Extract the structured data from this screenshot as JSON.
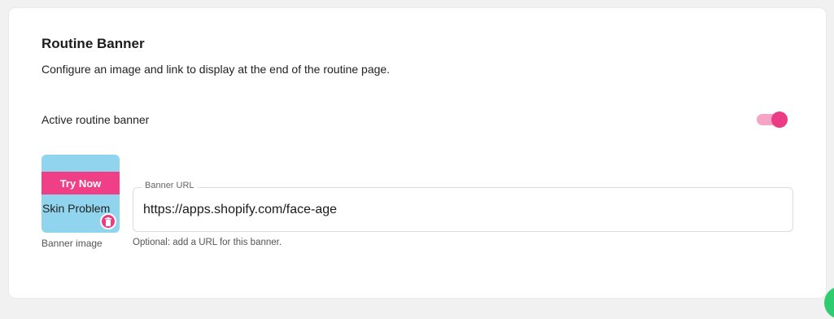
{
  "section": {
    "title": "Routine Banner",
    "description": "Configure an image and link to display at the end of the routine page."
  },
  "toggle": {
    "label": "Active routine banner",
    "state": "on"
  },
  "banner_image": {
    "try_now_text": "Try Now",
    "skin_text": "Skin Problem",
    "caption": "Banner image",
    "delete_icon": "trash-icon"
  },
  "banner_url": {
    "legend": "Banner URL",
    "value": "https://apps.shopify.com/face-age",
    "help": "Optional: add a URL for this banner."
  },
  "colors": {
    "accent": "#ec3a84",
    "toggle_track": "#f6a3c5",
    "thumb_bg": "#90d4ee",
    "fab": "#2ecc71"
  }
}
